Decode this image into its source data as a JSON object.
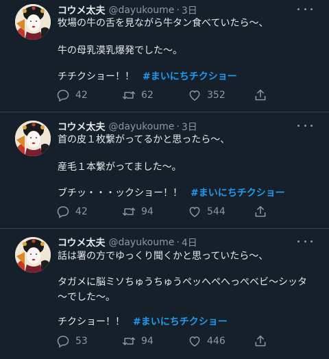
{
  "tweets": [
    {
      "name": "コウメ太夫",
      "handle": "@dayukoume",
      "separator": "·",
      "time": "3日",
      "lines": [
        "牧場の牛の舌を見ながら牛タン食べていたら〜、",
        "牛の母乳漠乳爆発でした〜。"
      ],
      "ending": "チチクショー！！",
      "hashtag": "#まいにちチクショー",
      "replies": "42",
      "retweets": "62",
      "likes": "352"
    },
    {
      "name": "コウメ太夫",
      "handle": "@dayukoume",
      "separator": "·",
      "time": "3日",
      "lines": [
        "首の皮１枚繋がってるかと思ったら〜、",
        "産毛１本繋がってました〜。"
      ],
      "ending": "ブチッ・・・ックショー！！",
      "hashtag": "#まいにちチクショー",
      "replies": "42",
      "retweets": "94",
      "likes": "544"
    },
    {
      "name": "コウメ太夫",
      "handle": "@dayukoume",
      "separator": "·",
      "time": "4日",
      "lines": [
        "話は署の方でゆっくり聞くかと思っていたら〜、",
        "タガメに脳ミソちゅうちゅうペッへペへっぺベビ〜シッタ",
        "〜でした〜。"
      ],
      "ending": "チクショー！！",
      "hashtag": "#まいにちチクショー",
      "replies": "53",
      "retweets": "94",
      "likes": "446"
    }
  ],
  "icons": {
    "reply": "speech-bubble-icon",
    "retweet": "retweet-arrows-icon",
    "like": "heart-outline-icon",
    "share": "upload-share-icon",
    "more": "three-dots-icon"
  },
  "colors": {
    "background": "#15202b",
    "text": "#e7e9ea",
    "muted": "#8b98a5",
    "hashtag": "#1d9bf0",
    "divider": "#38444d"
  }
}
